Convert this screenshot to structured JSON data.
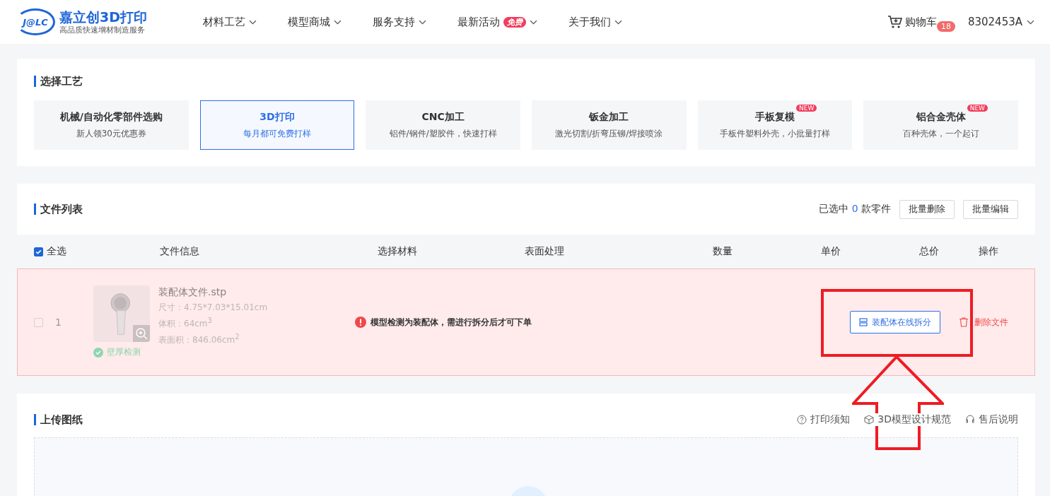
{
  "header": {
    "logo_mark": "J@LC",
    "logo_name": "嘉立创3D打印",
    "tagline": "高品质快速增材制造服务",
    "nav": [
      {
        "label": "材料工艺"
      },
      {
        "label": "模型商城"
      },
      {
        "label": "服务支持"
      },
      {
        "label": "最新活动",
        "badge": "免费"
      },
      {
        "label": "关于我们"
      }
    ],
    "cart": {
      "label": "购物车",
      "count": "18"
    },
    "user": "8302453A"
  },
  "process": {
    "title": "选择工艺",
    "options": [
      {
        "name": "机械/自动化零部件选购",
        "desc": "新人领30元优惠券",
        "selected": false
      },
      {
        "name": "3D打印",
        "desc": "每月都可免费打样",
        "selected": true
      },
      {
        "name": "CNC加工",
        "desc": "铝件/钢件/塑胶件，快速打样",
        "selected": false
      },
      {
        "name": "钣金加工",
        "desc": "激光切割/折弯压铆/焊接喷涂",
        "selected": false
      },
      {
        "name": "手板复模",
        "desc": "手板件塑料外壳，小批量打样",
        "selected": false,
        "badge": "NEW"
      },
      {
        "name": "铝合金壳体",
        "desc": "百种壳体，一个起订",
        "selected": false,
        "badge": "NEW"
      }
    ]
  },
  "files": {
    "title": "文件列表",
    "selected_prefix": "已选中",
    "selected_count": "0",
    "selected_suffix": "款零件",
    "buttons": [
      "批量删除",
      "批量编辑"
    ],
    "select_all": {
      "label": "全选",
      "checked": true
    },
    "columns": [
      "文件信息",
      "选择材料",
      "表面处理",
      "数量",
      "单价",
      "总价",
      "操作"
    ],
    "rows": [
      {
        "checked": false,
        "index": "1",
        "name": "装配体文件.stp",
        "size": "尺寸：4.75*7.03*15.01cm",
        "volume": "体积：64cm$^{3}$",
        "area": "表面积：846.06cm$^{2}$",
        "wall_check": "壁厚检测",
        "error": "模型检测为装配体，需进行拆分后才可下单",
        "split_button": "装配体在线拆分",
        "delete": "删除文件"
      }
    ]
  },
  "upload": {
    "title": "上传图纸",
    "links": [
      {
        "kind": "help",
        "label": "打印须知"
      },
      {
        "kind": "cube",
        "label": "3D模型设计规范"
      },
      {
        "kind": "headset",
        "label": "售后说明"
      }
    ]
  }
}
